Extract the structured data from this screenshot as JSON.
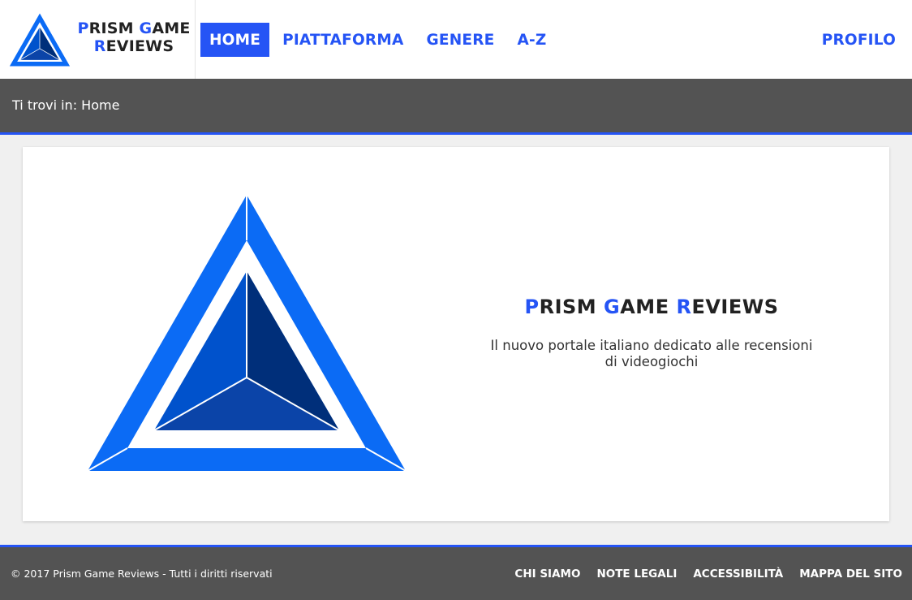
{
  "colors": {
    "accent": "#2554f5",
    "dark_bar": "#535353",
    "logo_blue": "#0b6bf5",
    "logo_dark": "#002f7a"
  },
  "header": {
    "logo": {
      "icon": "prism-triangle-logo-icon",
      "line1_first": "P",
      "line1_rest": "RISM ",
      "line1_g": "G",
      "line1_end": "AME",
      "line2_first": "R",
      "line2_rest": "EVIEWS"
    },
    "nav": {
      "home": "HOME",
      "platform": "PIATTAFORMA",
      "genre": "GENERE",
      "az": "A-Z",
      "profile": "PROFILO"
    }
  },
  "breadcrumb": {
    "text": "Ti trovi in: Home"
  },
  "main": {
    "hero_icon": "prism-triangle-logo-icon",
    "title": {
      "p": "P",
      "rism": "RISM ",
      "g": "G",
      "ame": "AME ",
      "r": "R",
      "eviews": "EVIEWS"
    },
    "description": "Il nuovo portale italiano dedicato alle recensioni di videogiochi"
  },
  "footer": {
    "copyright": "© 2017 Prism Game Reviews - Tutti i diritti riservati",
    "links": {
      "about": "CHI SIAMO",
      "legal": "NOTE LEGALI",
      "accessibility": "ACCESSIBILITÀ",
      "sitemap": "MAPPA DEL SITO"
    }
  }
}
